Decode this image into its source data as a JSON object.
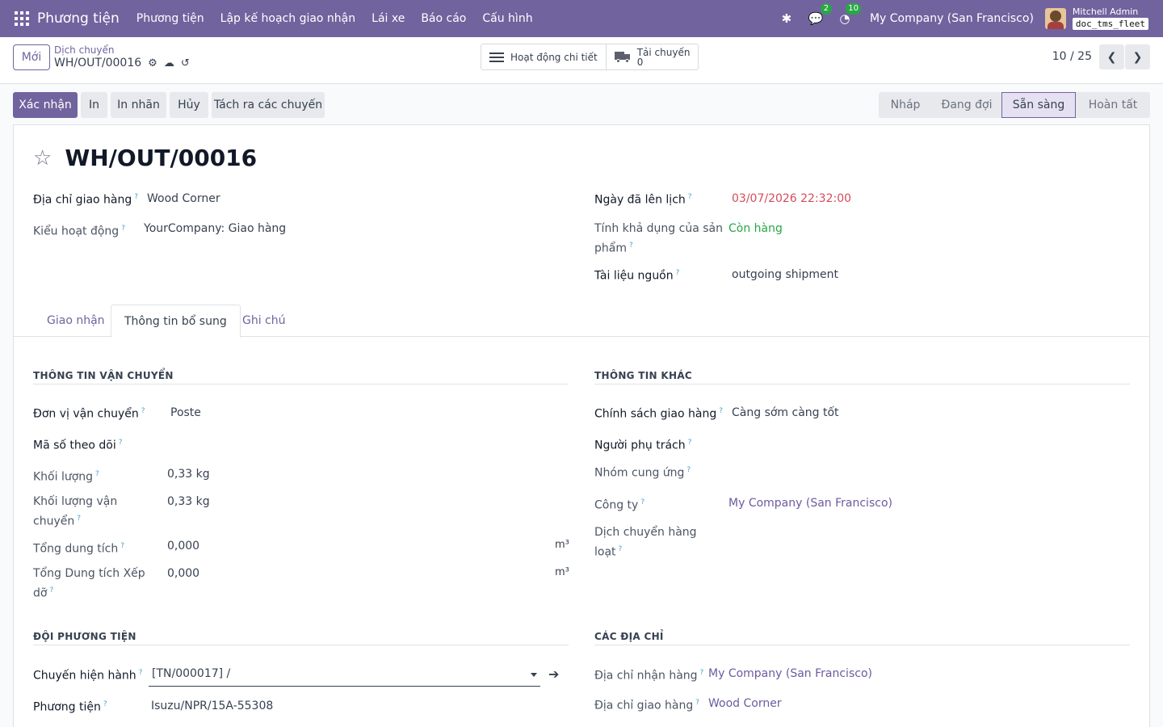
{
  "navbar": {
    "app_name": "Phương tiện",
    "menu": [
      "Phương tiện",
      "Lập kế hoạch giao nhận",
      "Lái xe",
      "Báo cáo",
      "Cấu hình"
    ],
    "messages_count": "2",
    "activities_count": "10",
    "company": "My Company (San Francisco)",
    "user_name": "Mitchell Admin",
    "database": "doc_tms_fleet"
  },
  "control": {
    "new_label": "Mới",
    "breadcrumb_parent": "Dịch chuyển",
    "breadcrumb_current": "WH/OUT/00016",
    "smart_buttons": {
      "activity_label": "Hoạt động chi tiết",
      "trips_label": "Tải chuyến",
      "trips_value": "0"
    },
    "pager": "10 / 25"
  },
  "actions": [
    "Xác nhận",
    "In",
    "In nhãn",
    "Hủy",
    "Tách ra các chuyến"
  ],
  "stages": [
    "Nháp",
    "Đang đợi",
    "Sẵn sàng",
    "Hoàn tất"
  ],
  "active_stage": "Sẵn sàng",
  "record": {
    "title": "WH/OUT/00016",
    "delivery_address_label": "Địa chỉ giao hàng",
    "delivery_address": "Wood Corner",
    "operation_type_label": "Kiểu hoạt động",
    "operation_type": "YourCompany: Giao hàng",
    "scheduled_date_label": "Ngày đã lên lịch",
    "scheduled_date": "03/07/2026 22:32:00",
    "availability_label_1": "Tính khả dụng của sản",
    "availability_label_2": "phẩm",
    "availability": "Còn hàng",
    "source_doc_label": "Tài liệu nguồn",
    "source_doc": "outgoing shipment"
  },
  "tabs": [
    "Giao nhận",
    "Thông tin bổ sung",
    "Ghi chú"
  ],
  "active_tab": "Thông tin bổ sung",
  "shipping_info": {
    "title": "THÔNG TIN VẬN CHUYỂN",
    "carrier_label": "Đơn vị vận chuyển",
    "carrier": "Poste",
    "tracking_label": "Mã số theo dõi",
    "weight_label": "Khối lượng",
    "weight": "0,33 kg",
    "shipping_weight_label_1": "Khối lượng vận",
    "shipping_weight_label_2": "chuyển",
    "shipping_weight": "0,33 kg",
    "volume_label": "Tổng dung tích",
    "volume": "0,000",
    "volume_unit": "m³",
    "pallet_volume_label_1": "Tổng Dung tích Xếp",
    "pallet_volume_label_2": "dỡ",
    "pallet_volume": "0,000",
    "pallet_volume_unit": "m³"
  },
  "other_info": {
    "title": "THÔNG TIN KHÁC",
    "policy_label": "Chính sách giao hàng",
    "policy": "Càng sớm càng tốt",
    "responsible_label": "Người phụ trách",
    "procurement_label": "Nhóm cung ứng",
    "company_label": "Công ty",
    "company": "My Company (San Francisco)",
    "batch_label_1": "Dịch chuyển hàng",
    "batch_label_2": "loạt"
  },
  "fleet": {
    "title": "ĐỘI PHƯƠNG TIỆN",
    "current_trip_label": "Chuyến hiện hành",
    "current_trip": "[TN/000017] /",
    "vehicle_label": "Phương tiện",
    "vehicle": "Isuzu/NPR/15A-55308"
  },
  "addresses": {
    "title": "CÁC ĐỊA CHỈ",
    "receive_label": "Địa chỉ nhận hàng",
    "receive": "My Company (San Francisco)",
    "deliver_label": "Địa chỉ giao hàng",
    "deliver": "Wood Corner"
  },
  "help_marker": "?",
  "colors": {
    "brand": "#71639e",
    "danger": "#d44c59",
    "success": "#28a745",
    "link": "#6d5a9f"
  }
}
